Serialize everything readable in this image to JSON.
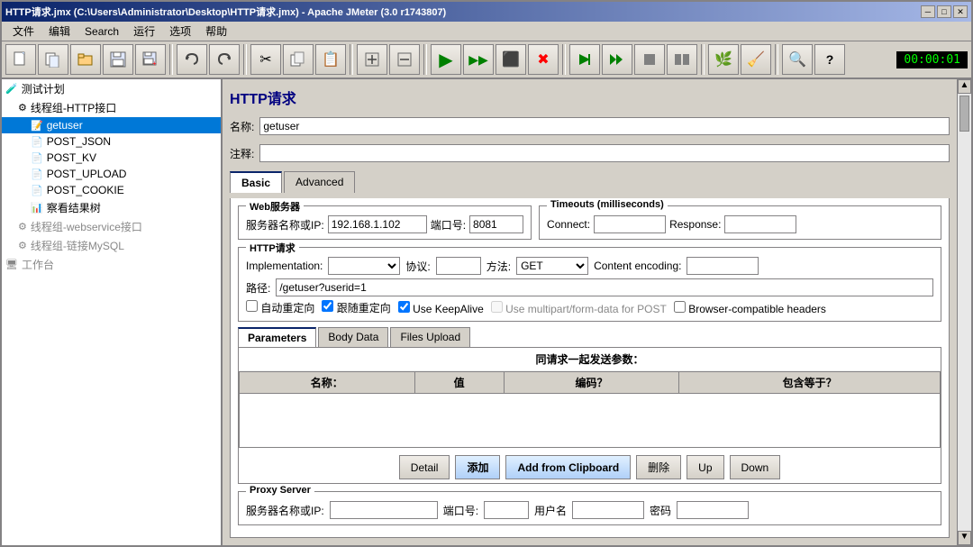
{
  "window": {
    "title": "HTTP请求.jmx (C:\\Users\\Administrator\\Desktop\\HTTP请求.jmx) - Apache JMeter (3.0 r1743807)"
  },
  "title_bar_controls": {
    "minimize": "─",
    "maximize": "□",
    "close": "✕"
  },
  "menu": {
    "items": [
      "文件",
      "编辑",
      "Search",
      "运行",
      "选项",
      "帮助"
    ]
  },
  "toolbar": {
    "timer": "00:00:01"
  },
  "tree": {
    "items": [
      {
        "label": "测试计划",
        "indent": 0,
        "icon": "🧪",
        "selected": false
      },
      {
        "label": "线程组-HTTP接口",
        "indent": 1,
        "icon": "⚙",
        "selected": false
      },
      {
        "label": "getuser",
        "indent": 2,
        "icon": "📝",
        "selected": true
      },
      {
        "label": "POST_JSON",
        "indent": 2,
        "icon": "📄",
        "selected": false
      },
      {
        "label": "POST_KV",
        "indent": 2,
        "icon": "📄",
        "selected": false
      },
      {
        "label": "POST_UPLOAD",
        "indent": 2,
        "icon": "📄",
        "selected": false
      },
      {
        "label": "POST_COOKIE",
        "indent": 2,
        "icon": "📄",
        "selected": false
      },
      {
        "label": "察看结果树",
        "indent": 2,
        "icon": "📊",
        "selected": false
      },
      {
        "label": "线程组-webservice接口",
        "indent": 1,
        "icon": "⚙",
        "selected": false
      },
      {
        "label": "线程组-链接MySQL",
        "indent": 1,
        "icon": "⚙",
        "selected": false
      },
      {
        "label": "工作台",
        "indent": 0,
        "icon": "🖥",
        "selected": false
      }
    ]
  },
  "panel": {
    "title": "HTTP请求",
    "name_label": "名称:",
    "name_value": "getuser",
    "comment_label": "注释:",
    "comment_value": "",
    "tabs": {
      "basic": "Basic",
      "advanced": "Advanced",
      "active": "Basic"
    },
    "web_server": {
      "section_title": "Web服务器",
      "server_label": "服务器名称或IP:",
      "server_value": "192.168.1.102",
      "port_label": "端口号:",
      "port_value": "8081"
    },
    "timeouts": {
      "section_title": "Timeouts (milliseconds)",
      "connect_label": "Connect:",
      "connect_value": "",
      "response_label": "Response:",
      "response_value": ""
    },
    "http_request": {
      "section_title": "HTTP请求",
      "implementation_label": "Implementation:",
      "implementation_value": "",
      "protocol_label": "协议:",
      "protocol_value": "",
      "method_label": "方法:",
      "method_value": "GET",
      "encoding_label": "Content encoding:",
      "encoding_value": "",
      "path_label": "路径:",
      "path_value": "/getuser?userid=1",
      "checkboxes": [
        {
          "label": "自动重定向",
          "checked": false
        },
        {
          "label": "跟随重定向",
          "checked": true
        },
        {
          "label": "Use KeepAlive",
          "checked": true
        },
        {
          "label": "Use multipart/form-data for POST",
          "checked": false
        },
        {
          "label": "Browser-compatible headers",
          "checked": false
        }
      ]
    },
    "sub_tabs": {
      "parameters": "Parameters",
      "body_data": "Body Data",
      "files_upload": "Files Upload",
      "active": "Parameters"
    },
    "params_table": {
      "columns": [
        "名称：",
        "值",
        "编码？",
        "包含等于？"
      ],
      "rows": []
    },
    "table_title": "同请求一起发送参数：",
    "buttons": {
      "detail": "Detail",
      "add": "添加",
      "add_clipboard": "Add from Clipboard",
      "delete": "删除",
      "up": "Up",
      "down": "Down"
    },
    "proxy": {
      "section_title": "Proxy Server",
      "server_label": "服务器名称或IP:",
      "server_value": "",
      "port_label": "端口号:",
      "port_value": "",
      "username_label": "用户名",
      "username_value": "",
      "password_label": "密码",
      "password_value": ""
    }
  }
}
